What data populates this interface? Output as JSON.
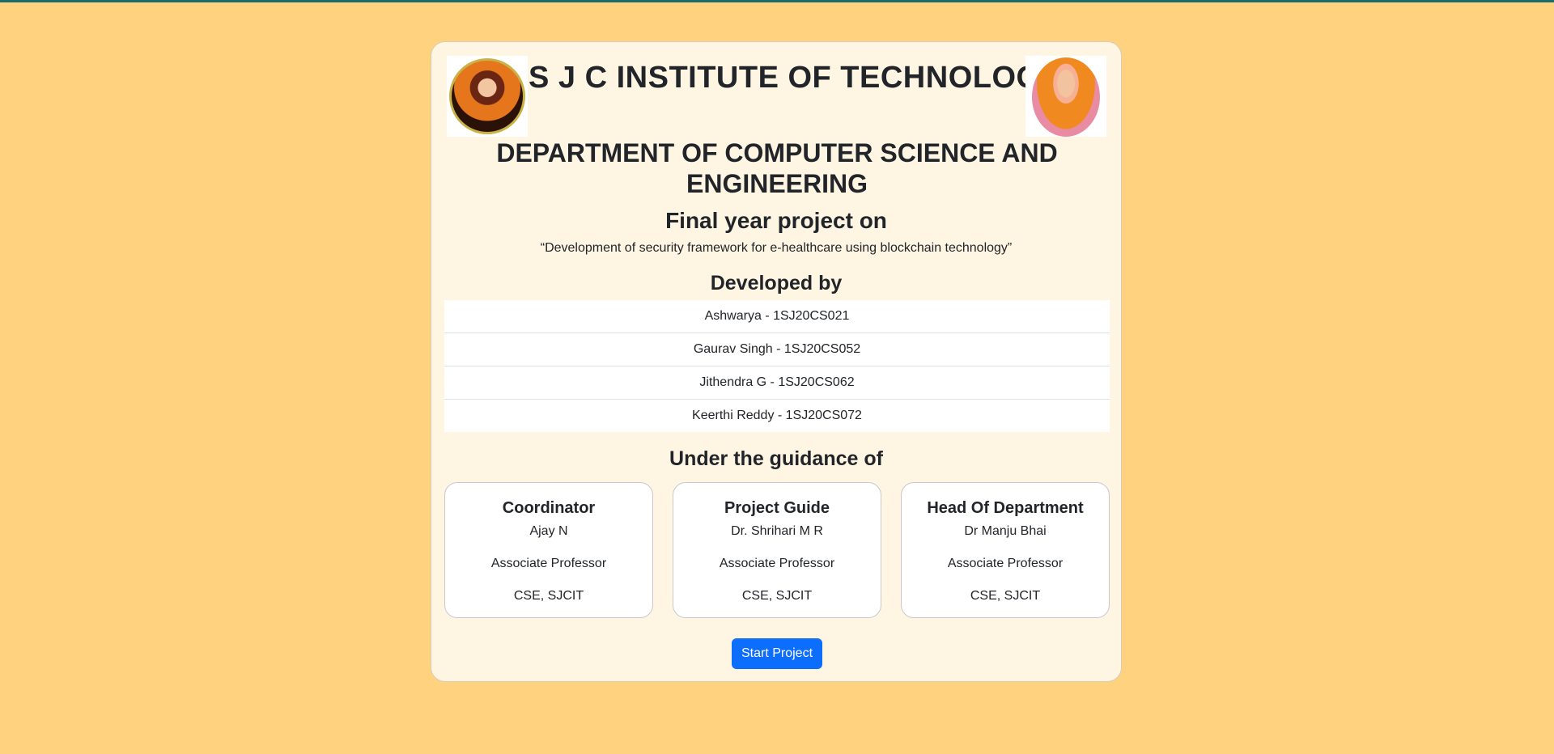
{
  "header": {
    "institute": "S J C INSTITUTE OF TECHNOLOGY",
    "department": "DEPARTMENT OF COMPUTER SCIENCE AND ENGINEERING",
    "left_image": "portrait-left",
    "right_image": "portrait-right"
  },
  "project": {
    "heading": "Final year project on",
    "title": "“Development of security framework for e-healthcare using blockchain technology”"
  },
  "developers": {
    "heading": "Developed by",
    "members": [
      "Ashwarya - 1SJ20CS021",
      "Gaurav Singh - 1SJ20CS052",
      "Jithendra G - 1SJ20CS062",
      "Keerthi Reddy - 1SJ20CS072"
    ]
  },
  "guidance": {
    "heading": "Under the guidance of",
    "cards": [
      {
        "role": "Coordinator",
        "name": "Ajay N",
        "designation": "Associate Professor",
        "dept": "CSE, SJCIT"
      },
      {
        "role": "Project Guide",
        "name": "Dr. Shrihari M R",
        "designation": "Associate Professor",
        "dept": "CSE, SJCIT"
      },
      {
        "role": "Head Of Department",
        "name": "Dr Manju Bhai",
        "designation": "Associate Professor",
        "dept": "CSE, SJCIT"
      }
    ]
  },
  "actions": {
    "start_label": "Start Project"
  },
  "colors": {
    "background": "#ffd27f",
    "card": "#fff5e3",
    "button": "#0d6efd"
  }
}
